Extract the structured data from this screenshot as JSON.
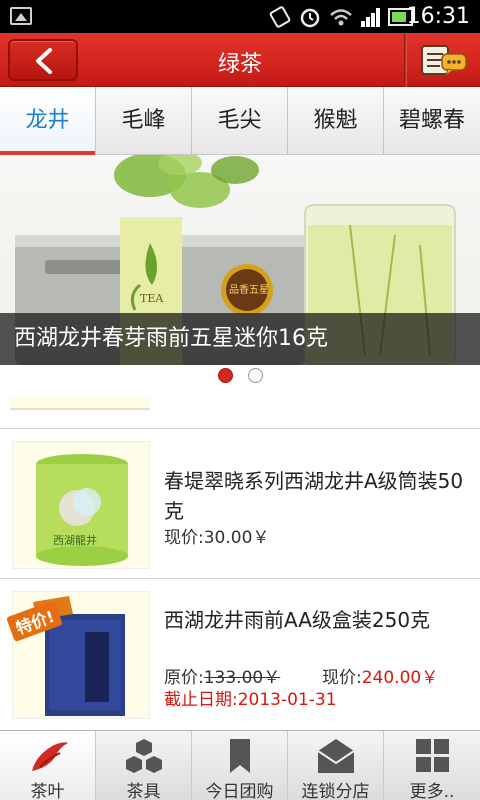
{
  "status_bar": {
    "time": "16:31"
  },
  "header": {
    "title": "绿茶"
  },
  "tabs": [
    {
      "label": "龙井",
      "active": true
    },
    {
      "label": "毛峰"
    },
    {
      "label": "毛尖"
    },
    {
      "label": "猴魁"
    },
    {
      "label": "碧螺春"
    }
  ],
  "banner": {
    "caption": "西湖龙井春芽雨前五星迷你16克",
    "product_text": "TEA",
    "badge_text": "品香五星",
    "current_slide": 1,
    "total_slides": 2
  },
  "products": [
    {
      "title": "春堤翠晓系列西湖龙井A级筒装50克",
      "current_price_label": "现价:30.00￥",
      "thumb_text": "西湖龍井"
    },
    {
      "title": "西湖龙井雨前AA级盒装250克",
      "special_tag": "特价!",
      "original_price_label": "原价:",
      "original_price": "133.00￥",
      "current_price_label": "现价:",
      "current_price": "240.00￥",
      "deadline": "截止日期:2013-01-31"
    }
  ],
  "bottom_nav": [
    {
      "label": "茶叶",
      "icon": "bird-logo-icon",
      "active": true
    },
    {
      "label": "茶具",
      "icon": "hexagons-icon"
    },
    {
      "label": "今日团购",
      "icon": "bookmark-icon"
    },
    {
      "label": "连锁分店",
      "icon": "envelope-icon"
    },
    {
      "label": "更多..",
      "icon": "grid-icon"
    }
  ],
  "colors": {
    "header_red": "#d2261d",
    "tab_active_blue": "#1e80c6",
    "price_red": "#d8180e"
  }
}
